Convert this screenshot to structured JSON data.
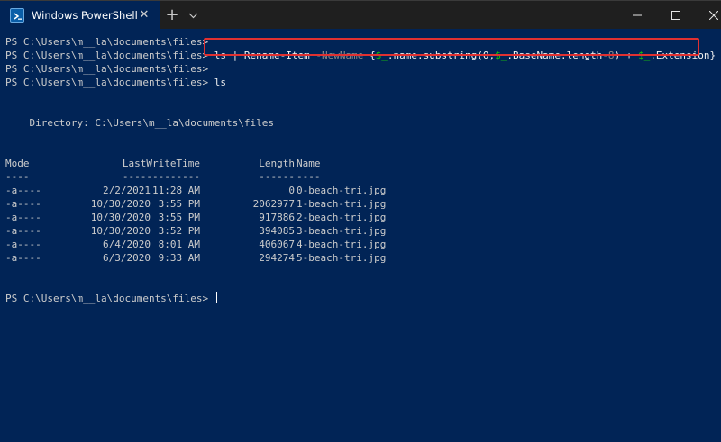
{
  "window": {
    "tab_title": "Windows PowerShell",
    "tab_close": "✕",
    "new_tab": "+",
    "icons": [
      "powershell-icon",
      "close-icon",
      "plus-icon",
      "chevron-down-icon",
      "minimize-icon",
      "maximize-icon",
      "window-close-icon"
    ]
  },
  "terminal": {
    "prompt": "PS C:\\Users\\m__la\\documents\\files>",
    "command": {
      "t1": "ls | Rename-Item ",
      "t2": "-NewName",
      "t3": " {",
      "t4": "$_",
      "t5": ".name.substring(0,",
      "t6": "$_",
      "t7": ".BaseName.length",
      "t8": "-8",
      "t9": ") + ",
      "t10": "$_",
      "t11": ".Extension}"
    },
    "ls_command": "ls",
    "directory_line": "    Directory: C:\\Users\\m__la\\documents\\files",
    "headers": {
      "mode": "Mode",
      "lastwritetime": "LastWriteTime",
      "length": "Length",
      "name": "Name"
    },
    "underlines": {
      "mode": "----",
      "lastwritetime": "-------------",
      "length": "------",
      "name": "----"
    },
    "rows": [
      {
        "mode": "-a----",
        "date": "2/2/2021",
        "time": "11:28 AM",
        "length": "0",
        "name": "0-beach-tri.jpg"
      },
      {
        "mode": "-a----",
        "date": "10/30/2020",
        "time": "3:55 PM",
        "length": "2062977",
        "name": "1-beach-tri.jpg"
      },
      {
        "mode": "-a----",
        "date": "10/30/2020",
        "time": "3:55 PM",
        "length": "917886",
        "name": "2-beach-tri.jpg"
      },
      {
        "mode": "-a----",
        "date": "10/30/2020",
        "time": "3:52 PM",
        "length": "394085",
        "name": "3-beach-tri.jpg"
      },
      {
        "mode": "-a----",
        "date": "6/4/2020",
        "time": "8:01 AM",
        "length": "406067",
        "name": "4-beach-tri.jpg"
      },
      {
        "mode": "-a----",
        "date": "6/3/2020",
        "time": "9:33 AM",
        "length": "294274",
        "name": "5-beach-tri.jpg"
      }
    ]
  },
  "colors": {
    "terminal_bg": "#012456",
    "titlebar_bg": "#1f1f1f",
    "highlight": "#e03131",
    "variable": "#16c60c",
    "parameter": "#8a8a8a"
  }
}
